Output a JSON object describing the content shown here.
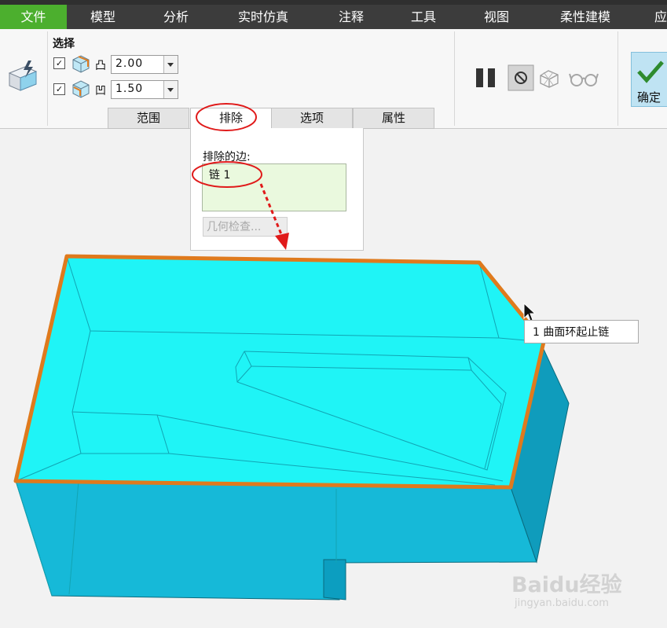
{
  "menu": {
    "items": [
      "文件",
      "模型",
      "分析",
      "实时仿真",
      "注释",
      "工具",
      "视图",
      "柔性建模",
      "应"
    ],
    "active_index": 0
  },
  "ribbon": {
    "select_label": "选择",
    "convex_label": "凸",
    "convex_value": "2.00",
    "concave_label": "凹",
    "concave_value": "1.50",
    "ok_label": "确定"
  },
  "tabs": [
    "范围",
    "排除",
    "选项",
    "属性"
  ],
  "active_tab": 1,
  "exclude_panel": {
    "title": "排除的边:",
    "list_items": [
      "链 1"
    ],
    "geometry_check_label": "几何检查..."
  },
  "tooltip": "1 曲面环起止链",
  "watermark": {
    "main": "Baidu经验",
    "sub": "jingyan.baidu.com"
  },
  "colors": {
    "menu_bg": "#3c3c3c",
    "file_tab": "#4caf2e",
    "model_top": "#1ff4f6",
    "model_side": "#16b9d8",
    "edge_highlight": "#df7a1d",
    "annotation_red": "#e01a1a",
    "list_bg": "#eaf9de",
    "ok_button": "#bfe3f3"
  },
  "icons": [
    "round-feature-icon",
    "convex-edge-icon",
    "concave-edge-icon",
    "pause-icon",
    "stop-icon",
    "preview-icon",
    "verify-glasses-icon",
    "checkmark-icon",
    "mouse-cursor-icon"
  ]
}
